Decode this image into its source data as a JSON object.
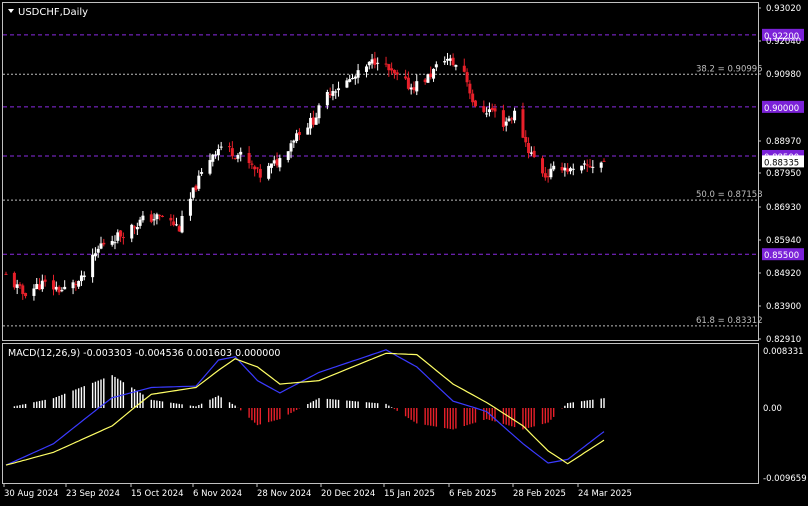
{
  "window": {
    "title": "USDCHF,Daily",
    "menu_icon": "triangle-down-icon"
  },
  "colors": {
    "background": "#000000",
    "frame": "#c0c0c0",
    "text": "#ffffff",
    "bull_candle": "#ffffff",
    "bear_candle": "#e8202a",
    "level_line": "#8a2be2",
    "level_label_bg": "#7b22d8",
    "fib_line": "#bdbdbd",
    "macd_line": "#3a3aff",
    "signal_line": "#ffff66",
    "hist_pos": "#ffffff",
    "hist_neg": "#e8202a",
    "price_label_bg": "#ffffff"
  },
  "price_axis": {
    "ticks": [
      "0.93020",
      "0.92040",
      "0.90980",
      "0.88970",
      "0.87950",
      "0.86930",
      "0.85940",
      "0.84920",
      "0.83900",
      "0.82910"
    ],
    "current_price": "0.88335"
  },
  "levels": [
    {
      "label": "0.92200",
      "value": 0.922
    },
    {
      "label": "0.90000",
      "value": 0.9
    },
    {
      "label": "0.88500",
      "value": 0.885
    },
    {
      "label": "0.85500",
      "value": 0.855
    }
  ],
  "fib_levels": [
    {
      "label": "38.2 = 0.90995",
      "value": 0.90995
    },
    {
      "label": "50.0 = 0.87153",
      "value": 0.87153
    },
    {
      "label": "61.8 = 0.83312",
      "value": 0.83312
    }
  ],
  "macd": {
    "label": "MACD(12,26,9) -0.003303 -0.004536 0.001603 0.000000",
    "ticks": [
      "0.008331",
      "0.00",
      "-0.009659"
    ]
  },
  "x_axis": {
    "labels": [
      "30 Aug 2024",
      "23 Sep 2024",
      "15 Oct 2024",
      "6 Nov 2024",
      "28 Nov 2024",
      "20 Dec 2024",
      "15 Jan 2025",
      "6 Feb 2025",
      "28 Feb 2025",
      "24 Mar 2025"
    ]
  },
  "chart_data": {
    "type": "candlestick",
    "title": "USDCHF,Daily",
    "ylim": [
      0.8291,
      0.9302
    ],
    "anchors": [
      {
        "date": "2024-08-30",
        "close": 0.8485
      },
      {
        "date": "2024-09-05",
        "close": 0.843
      },
      {
        "date": "2024-09-12",
        "close": 0.846
      },
      {
        "date": "2024-09-19",
        "close": 0.844
      },
      {
        "date": "2024-09-26",
        "close": 0.847
      },
      {
        "date": "2024-10-03",
        "close": 0.858
      },
      {
        "date": "2024-10-10",
        "close": 0.861
      },
      {
        "date": "2024-10-18",
        "close": 0.8655
      },
      {
        "date": "2024-10-25",
        "close": 0.8665
      },
      {
        "date": "2024-10-31",
        "close": 0.863
      },
      {
        "date": "2024-11-06",
        "close": 0.876
      },
      {
        "date": "2024-11-12",
        "close": 0.886
      },
      {
        "date": "2024-11-15",
        "close": 0.888
      },
      {
        "date": "2024-11-22",
        "close": 0.885
      },
      {
        "date": "2024-11-29",
        "close": 0.879
      },
      {
        "date": "2024-12-06",
        "close": 0.884
      },
      {
        "date": "2024-12-12",
        "close": 0.892
      },
      {
        "date": "2024-12-18",
        "close": 0.896
      },
      {
        "date": "2024-12-24",
        "close": 0.905
      },
      {
        "date": "2025-01-02",
        "close": 0.909
      },
      {
        "date": "2025-01-10",
        "close": 0.915
      },
      {
        "date": "2025-01-15",
        "close": 0.91
      },
      {
        "date": "2025-01-22",
        "close": 0.906
      },
      {
        "date": "2025-01-28",
        "close": 0.909
      },
      {
        "date": "2025-02-03",
        "close": 0.915
      },
      {
        "date": "2025-02-10",
        "close": 0.911
      },
      {
        "date": "2025-02-14",
        "close": 0.899
      },
      {
        "date": "2025-02-20",
        "close": 0.899
      },
      {
        "date": "2025-02-24",
        "close": 0.895
      },
      {
        "date": "2025-02-28",
        "close": 0.898
      },
      {
        "date": "2025-03-05",
        "close": 0.887
      },
      {
        "date": "2025-03-11",
        "close": 0.879
      },
      {
        "date": "2025-03-17",
        "close": 0.882
      },
      {
        "date": "2025-03-21",
        "close": 0.88
      },
      {
        "date": "2025-03-27",
        "close": 0.882
      },
      {
        "date": "2025-04-01",
        "close": 0.8834
      }
    ],
    "macd_ylim": [
      -0.009659,
      0.008331
    ],
    "macd_anchors": [
      {
        "date": "2024-08-30",
        "macd": -0.008,
        "signal": -0.008
      },
      {
        "date": "2024-09-16",
        "macd": -0.005,
        "signal": -0.0062
      },
      {
        "date": "2024-10-07",
        "macd": 0.0015,
        "signal": -0.0025
      },
      {
        "date": "2024-10-21",
        "macd": 0.003,
        "signal": 0.002
      },
      {
        "date": "2024-11-06",
        "macd": 0.0032,
        "signal": 0.003
      },
      {
        "date": "2024-11-14",
        "macd": 0.007,
        "signal": 0.0055
      },
      {
        "date": "2024-11-20",
        "macd": 0.0075,
        "signal": 0.0072
      },
      {
        "date": "2024-11-28",
        "macd": 0.004,
        "signal": 0.006
      },
      {
        "date": "2024-12-06",
        "macd": 0.0022,
        "signal": 0.0035
      },
      {
        "date": "2024-12-20",
        "macd": 0.0052,
        "signal": 0.004
      },
      {
        "date": "2025-01-13",
        "macd": 0.0085,
        "signal": 0.008
      },
      {
        "date": "2025-01-24",
        "macd": 0.006,
        "signal": 0.0078
      },
      {
        "date": "2025-02-06",
        "macd": 0.001,
        "signal": 0.0035
      },
      {
        "date": "2025-02-18",
        "macd": -0.0005,
        "signal": 0.0008
      },
      {
        "date": "2025-03-03",
        "macd": -0.005,
        "signal": -0.0025
      },
      {
        "date": "2025-03-12",
        "macd": -0.0077,
        "signal": -0.006
      },
      {
        "date": "2025-03-19",
        "macd": -0.0072,
        "signal": -0.0078
      },
      {
        "date": "2025-04-01",
        "macd": -0.0033,
        "signal": -0.0045
      }
    ]
  }
}
